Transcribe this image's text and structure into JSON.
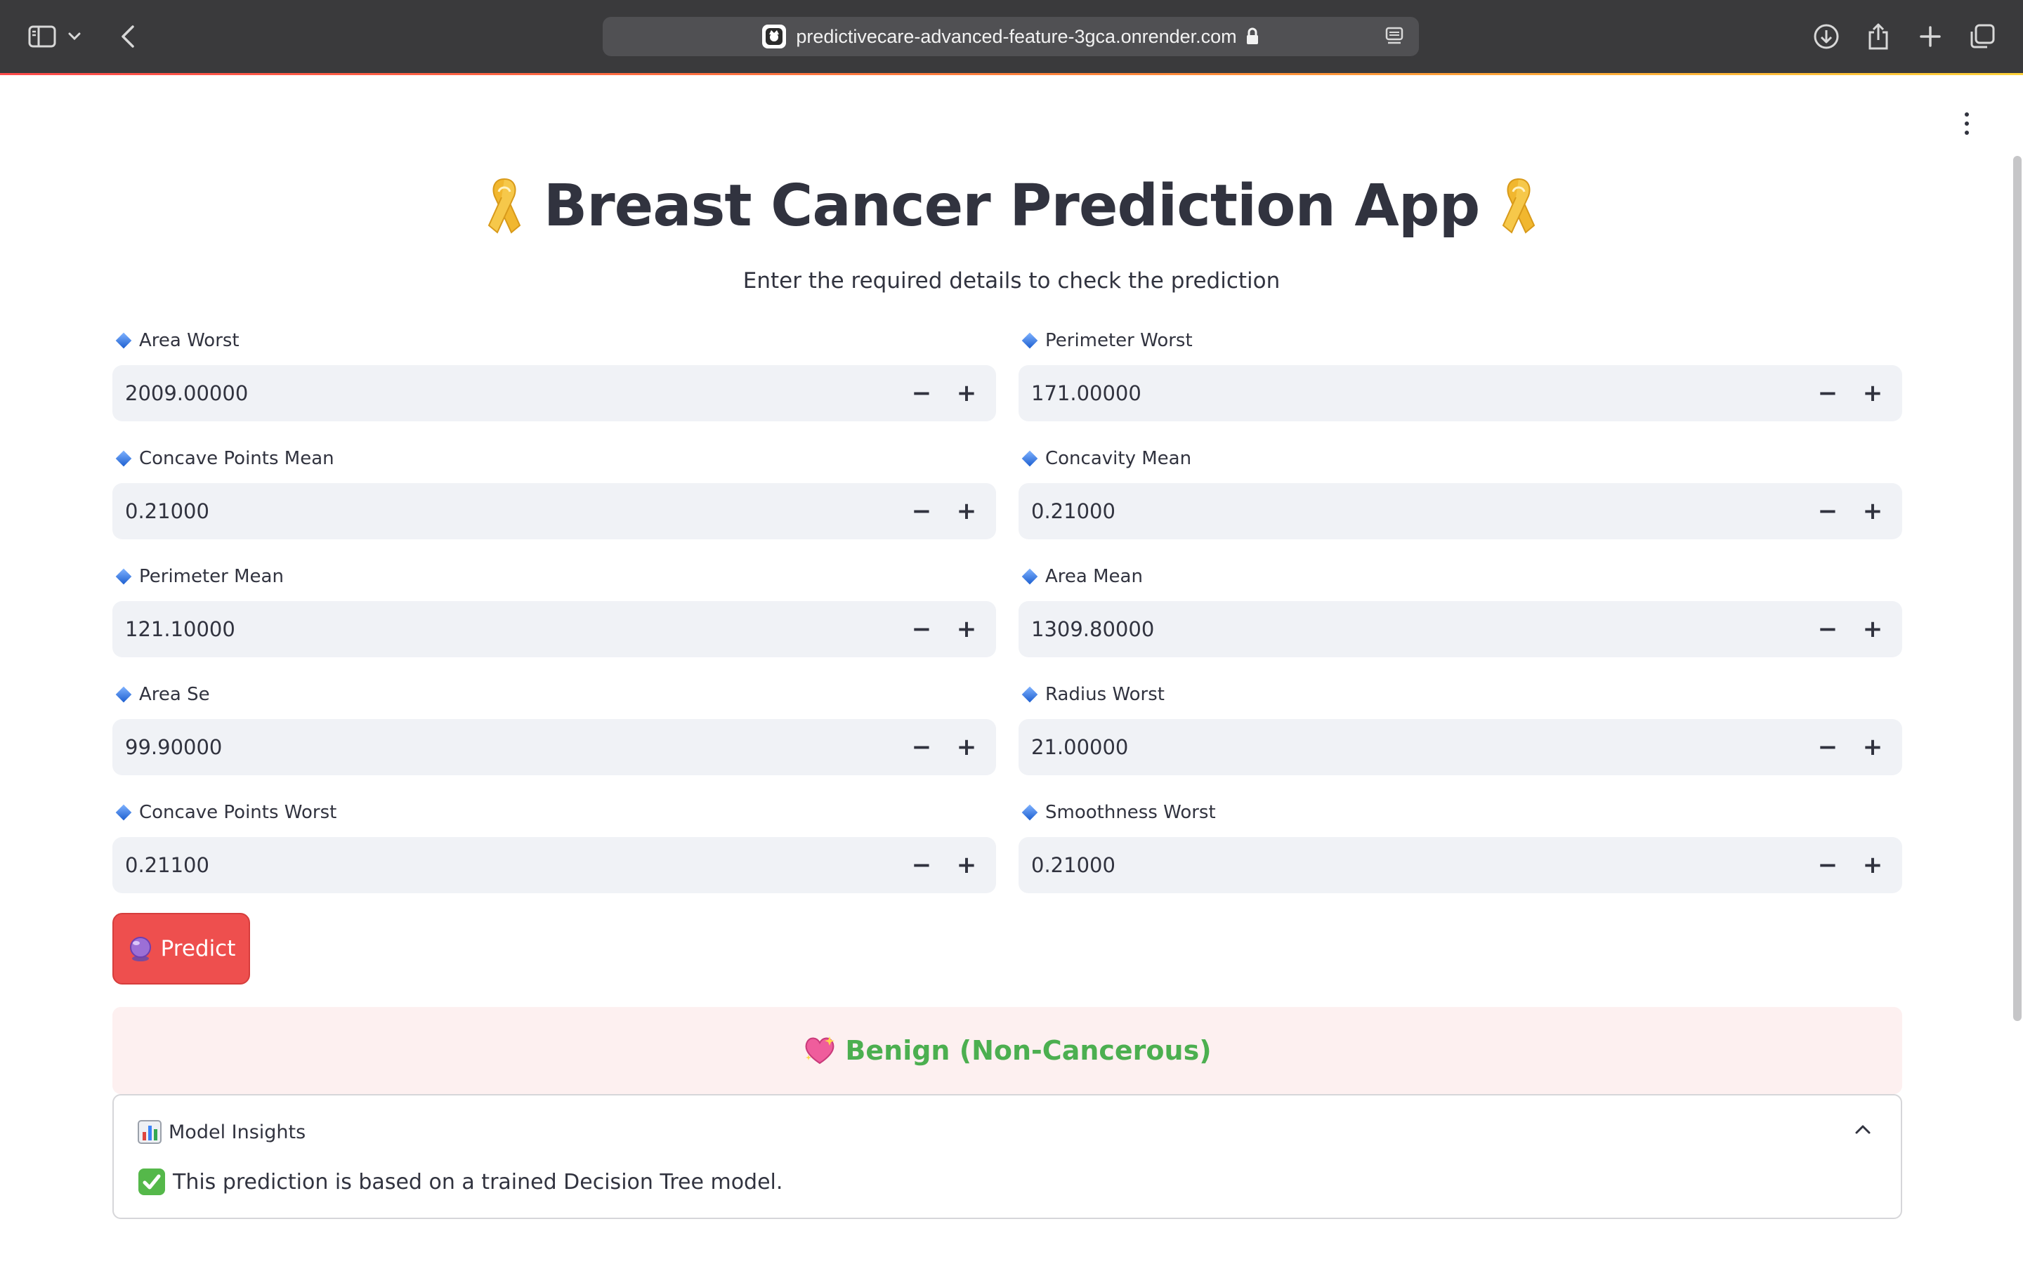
{
  "browser": {
    "url": "predictivecare-advanced-feature-3gca.onrender.com"
  },
  "app": {
    "title": "Breast Cancer Prediction App",
    "subtitle": "Enter the required details to check the prediction",
    "fields": [
      {
        "label": "Area Worst",
        "value": "2009.00000"
      },
      {
        "label": "Perimeter Worst",
        "value": "171.00000"
      },
      {
        "label": "Concave Points Mean",
        "value": "0.21000"
      },
      {
        "label": "Concavity Mean",
        "value": "0.21000"
      },
      {
        "label": "Perimeter Mean",
        "value": "121.10000"
      },
      {
        "label": "Area Mean",
        "value": "1309.80000"
      },
      {
        "label": "Area Se",
        "value": "99.90000"
      },
      {
        "label": "Radius Worst",
        "value": "21.00000"
      },
      {
        "label": "Concave Points Worst",
        "value": "0.21100"
      },
      {
        "label": "Smoothness Worst",
        "value": "0.21000"
      }
    ],
    "stepper": {
      "minus": "−",
      "plus": "+"
    },
    "predict_label": "Predict",
    "result_label": "Benign (Non-Cancerous)",
    "insights": {
      "header": "Model Insights",
      "body": "This prediction is based on a trained Decision Tree model."
    }
  },
  "colors": {
    "primary": "#ee4f4e",
    "success_text": "#4caf50",
    "result_bg": "#fdf0f0",
    "input_bg": "#f0f2f6",
    "text": "#31333f"
  },
  "icons": {
    "ribbon": "ribbon-icon",
    "diamond": "blue-diamond-icon",
    "crystal": "crystal-ball-icon",
    "heart": "sparkling-heart-icon",
    "chart": "bar-chart-icon",
    "check": "check-mark-icon"
  }
}
